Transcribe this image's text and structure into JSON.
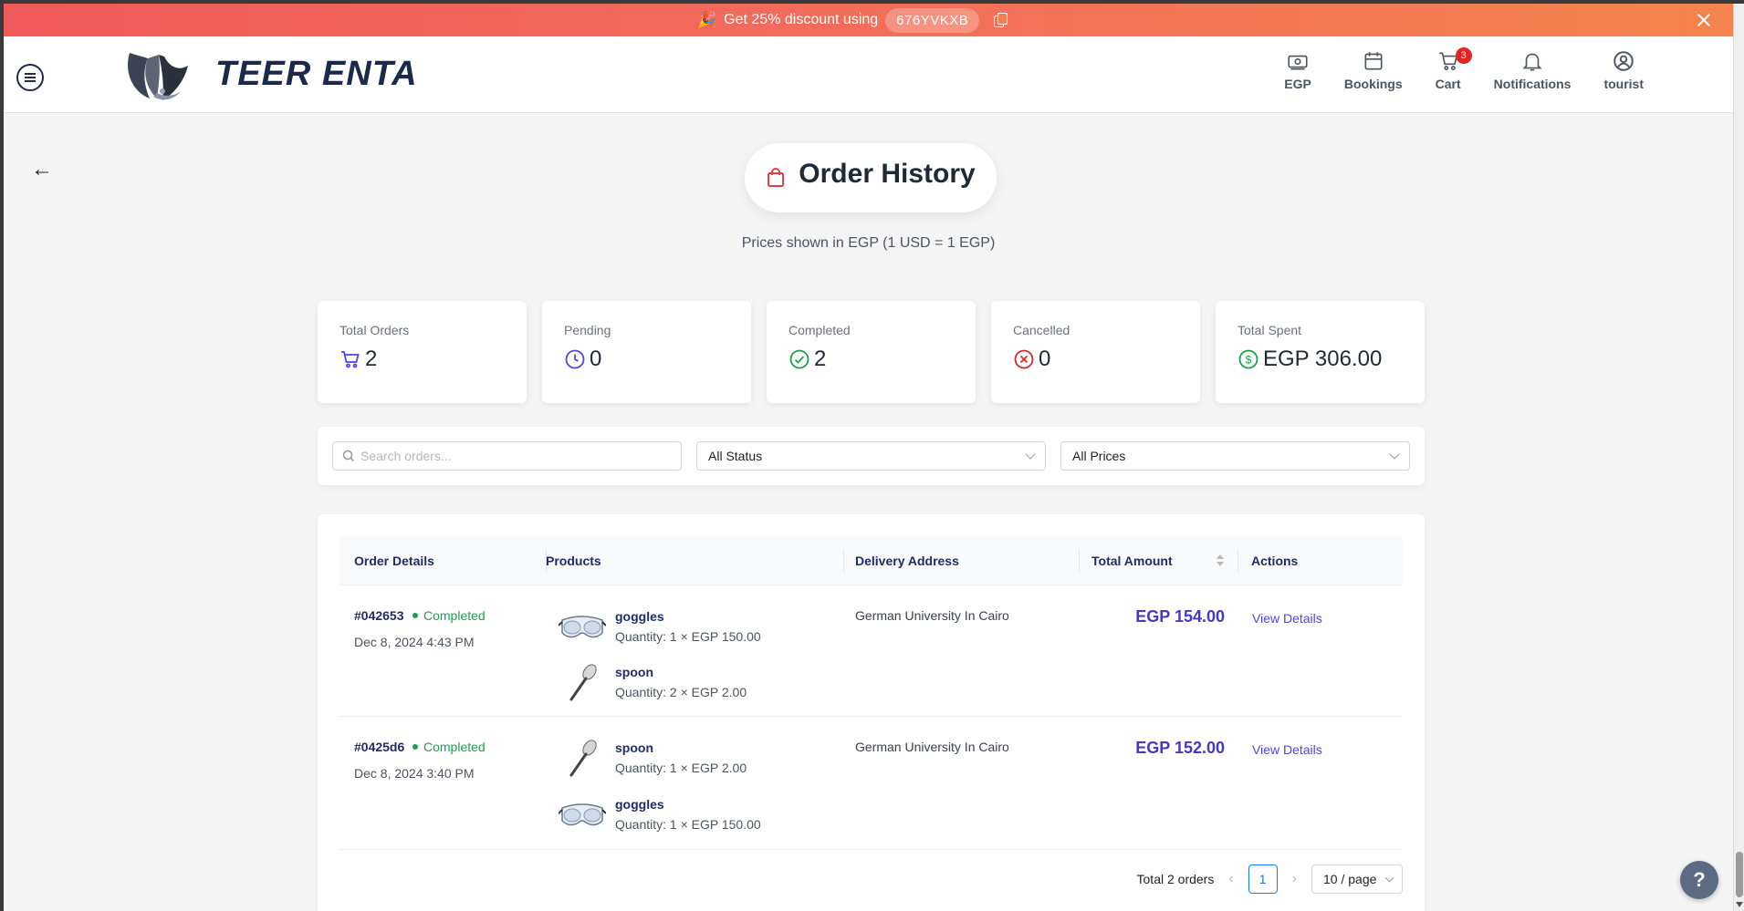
{
  "banner": {
    "text": "Get 25% discount using",
    "code": "676YVKXB"
  },
  "header": {
    "brand": "TEER ENTA",
    "nav": [
      {
        "label": "EGP",
        "icon": "currency-icon"
      },
      {
        "label": "Bookings",
        "icon": "calendar-icon"
      },
      {
        "label": "Cart",
        "icon": "cart-icon",
        "badge": "3"
      },
      {
        "label": "Notifications",
        "icon": "bell-icon"
      },
      {
        "label": "tourist",
        "icon": "user-icon"
      }
    ]
  },
  "page": {
    "back": "←",
    "title": "Order History",
    "subtitle": "Prices shown in EGP (1 USD = 1 EGP)"
  },
  "stats": [
    {
      "label": "Total Orders",
      "value": "2",
      "icon": "cart-icon",
      "color": "#4f46e5"
    },
    {
      "label": "Pending",
      "value": "0",
      "icon": "clock-icon",
      "color": "#4f46e5"
    },
    {
      "label": "Completed",
      "value": "2",
      "icon": "check-circle-icon",
      "color": "#16a34a"
    },
    {
      "label": "Cancelled",
      "value": "0",
      "icon": "x-circle-icon",
      "color": "#dc2626"
    },
    {
      "label": "Total Spent",
      "value": "EGP 306.00",
      "icon": "dollar-circle-icon",
      "color": "#16a34a"
    }
  ],
  "filters": {
    "search_placeholder": "Search orders...",
    "status": "All Status",
    "prices": "All Prices"
  },
  "table": {
    "columns": [
      "Order Details",
      "Products",
      "Delivery Address",
      "Total Amount",
      "Actions"
    ],
    "rows": [
      {
        "id": "#042653",
        "status": "Completed",
        "date": "Dec 8, 2024 4:43 PM",
        "products": [
          {
            "name": "goggles",
            "qty": "Quantity: 1 × EGP 150.00",
            "icon": "goggles-image"
          },
          {
            "name": "spoon",
            "qty": "Quantity: 2 × EGP 2.00",
            "icon": "spoon-image"
          }
        ],
        "address": "German University In Cairo",
        "total": "EGP 154.00",
        "action": "View Details"
      },
      {
        "id": "#0425d6",
        "status": "Completed",
        "date": "Dec 8, 2024 3:40 PM",
        "products": [
          {
            "name": "spoon",
            "qty": "Quantity: 1 × EGP 2.00",
            "icon": "spoon-image"
          },
          {
            "name": "goggles",
            "qty": "Quantity: 1 × EGP 150.00",
            "icon": "goggles-image"
          }
        ],
        "address": "German University In Cairo",
        "total": "EGP 152.00",
        "action": "View Details"
      }
    ]
  },
  "pagination": {
    "total": "Total 2 orders",
    "current_page": "1",
    "page_size": "10 / page"
  },
  "help": "?"
}
